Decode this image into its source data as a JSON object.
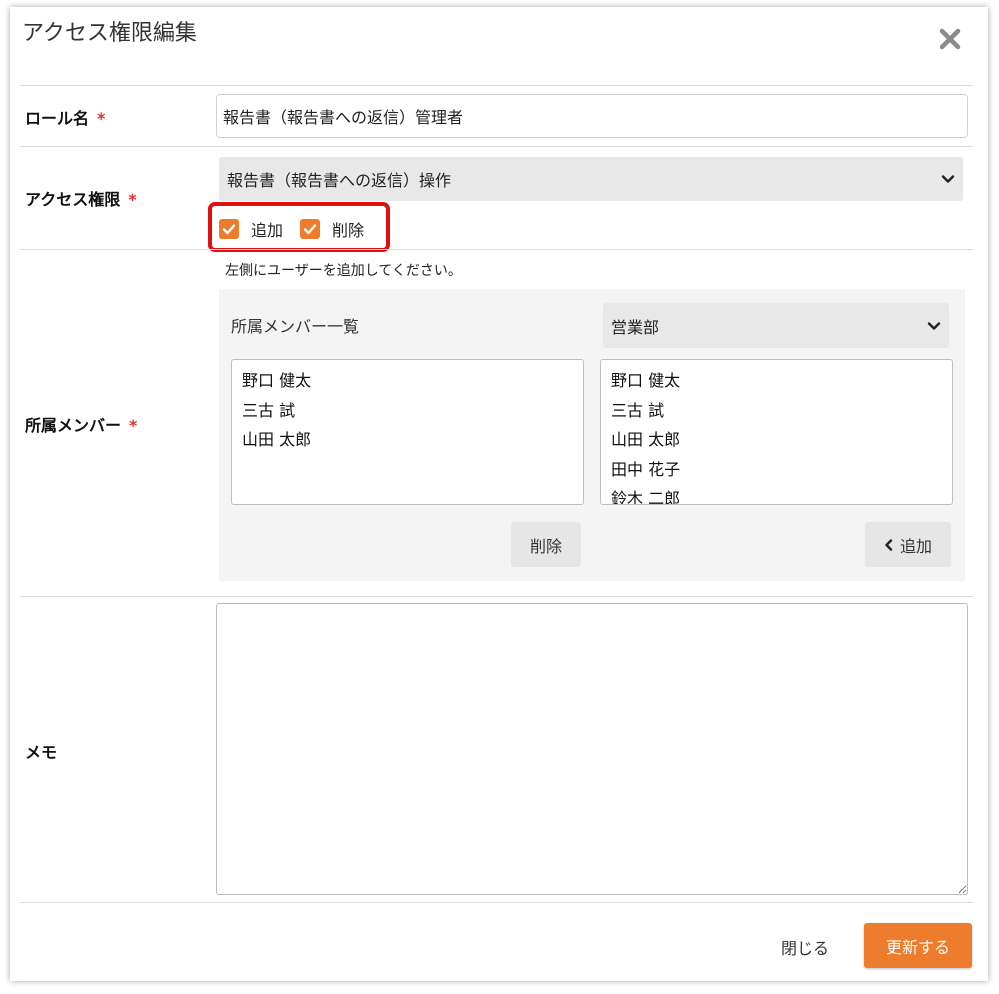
{
  "modal": {
    "title": "アクセス権限編集"
  },
  "role_name": {
    "label": "ロール名",
    "required_mark": "*",
    "value": "報告書（報告書への返信）管理者"
  },
  "access": {
    "label": "アクセス権限",
    "required_mark": "*",
    "selected": "報告書（報告書への返信）操作",
    "checkboxes": [
      {
        "label": "追加",
        "checked": true
      },
      {
        "label": "削除",
        "checked": true
      }
    ]
  },
  "members": {
    "label": "所属メンバー",
    "required_mark": "*",
    "hint": "左側にユーザーを追加してください。",
    "list_title": "所属メンバー一覧",
    "department_selected": "営業部",
    "assigned": [
      "野口 健太",
      "三古 試",
      "山田 太郎"
    ],
    "available": [
      "野口 健太",
      "三古 試",
      "山田 太郎",
      "田中 花子",
      "鈴木 二郎"
    ],
    "remove_button": "削除",
    "add_button": "追加"
  },
  "memo": {
    "label": "メモ",
    "value": ""
  },
  "footer": {
    "close_label": "閉じる",
    "submit_label": "更新する"
  },
  "colors": {
    "accent": "#ee7c2d",
    "required": "#e03030",
    "highlight": "#e01010"
  },
  "icons": {
    "close": "close-icon",
    "chevron": "chevron-down-icon",
    "check": "check-icon",
    "chevron_left": "chevron-left-icon"
  }
}
